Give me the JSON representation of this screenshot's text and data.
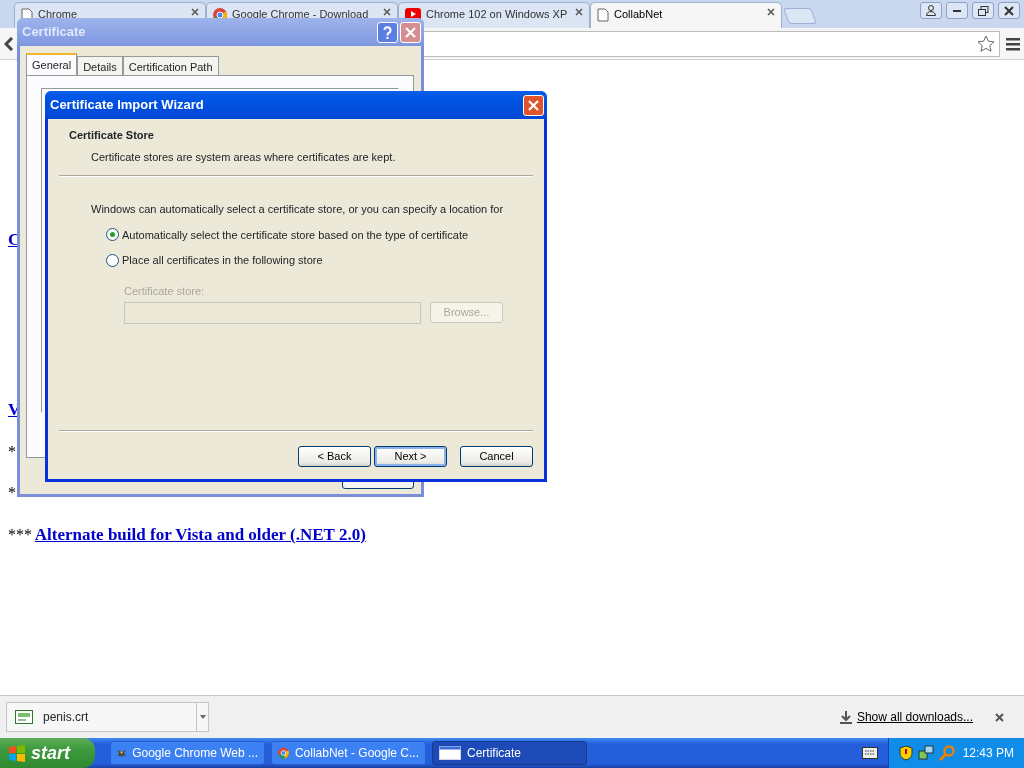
{
  "browser": {
    "tabs": [
      {
        "title": "Chrome",
        "selected": false
      },
      {
        "title": "Google Chrome - Download",
        "selected": false
      },
      {
        "title": "Chrome 102 on Windows XP",
        "selected": false
      },
      {
        "title": "CollabNet",
        "selected": true
      }
    ]
  },
  "page": {
    "lines": [
      {
        "kind": "link",
        "text": "C"
      },
      {
        "kind": "link",
        "text": "V"
      },
      {
        "kind": "text",
        "text": "*"
      },
      {
        "kind": "text",
        "text": "*"
      },
      {
        "kind": "mixed",
        "prefix": "***",
        "link": "Alternate build for Vista and older (.NET 2.0)"
      }
    ]
  },
  "certificate_dialog": {
    "title": "Certificate",
    "tabs": [
      {
        "label": "General",
        "selected": true
      },
      {
        "label": "Details",
        "selected": false
      },
      {
        "label": "Certification Path",
        "selected": false
      }
    ]
  },
  "wizard": {
    "title": "Certificate Import Wizard",
    "heading": "Certificate Store",
    "subheading": "Certificate stores are system areas where certificates are kept.",
    "intro": "Windows can automatically select a certificate store, or you can specify a location for",
    "options": [
      {
        "label": "Automatically select the certificate store based on the type of certificate",
        "selected": true
      },
      {
        "label": "Place all certificates in the following store",
        "selected": false
      }
    ],
    "store_label": "Certificate store:",
    "store_disabled": true,
    "browse": "Browse...",
    "buttons": [
      {
        "label": "< Back",
        "default": false
      },
      {
        "label": "Next >",
        "default": true
      },
      {
        "label": "Cancel",
        "default": false
      }
    ]
  },
  "downloads": {
    "file": "penis.crt",
    "show_all": "Show all downloads..."
  },
  "taskbar": {
    "start": "start",
    "tasks": [
      {
        "label": "Google Chrome Web ...",
        "selected": false
      },
      {
        "label": "CollabNet - Google C...",
        "selected": false
      },
      {
        "label": "Certificate",
        "selected": true
      }
    ],
    "clock": "12:43 PM"
  }
}
